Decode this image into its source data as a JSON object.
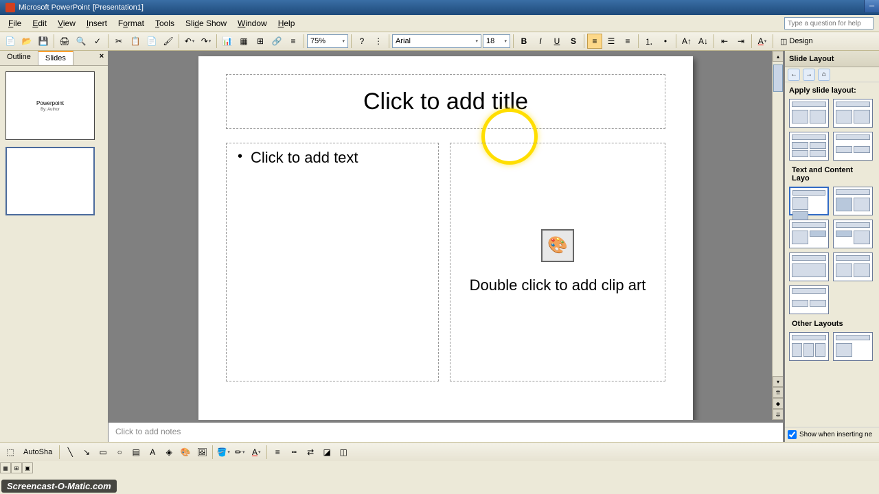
{
  "titlebar": {
    "app": "Microsoft PowerPoint",
    "doc": "[Presentation1]"
  },
  "menus": [
    "File",
    "Edit",
    "View",
    "Insert",
    "Format",
    "Tools",
    "Slide Show",
    "Window",
    "Help"
  ],
  "menus_accel": [
    "F",
    "E",
    "V",
    "I",
    "o",
    "T",
    "S",
    "W",
    "H"
  ],
  "help_placeholder": "Type a question for help",
  "zoom": "75%",
  "font_name": "Arial",
  "font_size": "18",
  "design_label": "Design",
  "slidepane": {
    "tab_outline": "Outline",
    "tab_slides": "Slides",
    "thumb1_title": "Powerpoint",
    "thumb1_sub": "By: Author"
  },
  "slide": {
    "title_placeholder": "Click to add title",
    "text_placeholder": "Click to add text",
    "clipart_placeholder": "Double click to add clip art"
  },
  "notes_placeholder": "Click to add notes",
  "taskpane": {
    "title": "Slide Layout",
    "apply_label": "Apply slide layout:",
    "section_text": "Text and Content Layo",
    "section_other": "Other Layouts",
    "show_check": "Show when inserting ne"
  },
  "autoshapes_label": "AutoSha",
  "watermark": "Screencast-O-Matic.com"
}
